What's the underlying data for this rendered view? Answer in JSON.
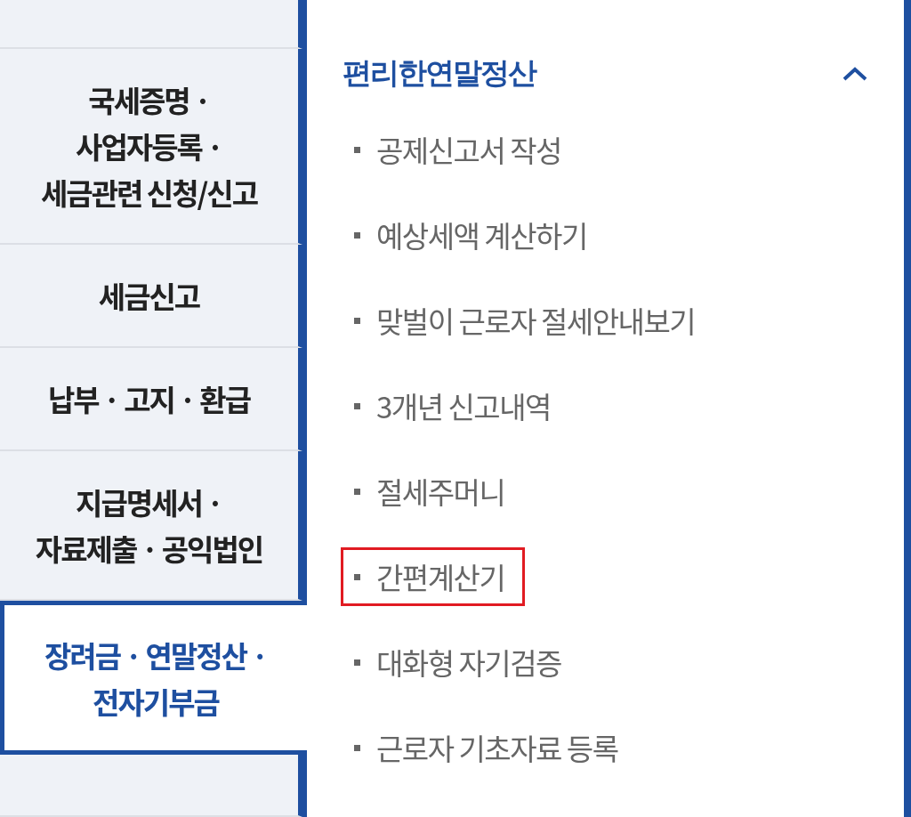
{
  "sidebar": {
    "items": [
      {
        "lines": [
          "국세증명 ·",
          "사업자등록 ·",
          "세금관련 신청/신고"
        ],
        "selected": false
      },
      {
        "lines": [
          "세금신고"
        ],
        "selected": false
      },
      {
        "lines": [
          "납부 · 고지 · 환급"
        ],
        "selected": false
      },
      {
        "lines": [
          "지급명세서 ·",
          "자료제출 · 공익법인"
        ],
        "selected": false
      },
      {
        "lines": [
          "장려금 · 연말정산 ·",
          "전자기부금"
        ],
        "selected": true
      }
    ]
  },
  "panel": {
    "title": "편리한연말정산",
    "expanded": true,
    "items": [
      {
        "label": "공제신고서 작성",
        "highlighted": false
      },
      {
        "label": "예상세액 계산하기",
        "highlighted": false
      },
      {
        "label": "맞벌이 근로자 절세안내보기",
        "highlighted": false
      },
      {
        "label": "3개년 신고내역",
        "highlighted": false
      },
      {
        "label": "절세주머니",
        "highlighted": false
      },
      {
        "label": "간편계산기",
        "highlighted": true
      },
      {
        "label": "대화형 자기검증",
        "highlighted": false
      },
      {
        "label": "근로자 기초자료 등록",
        "highlighted": false
      }
    ]
  }
}
